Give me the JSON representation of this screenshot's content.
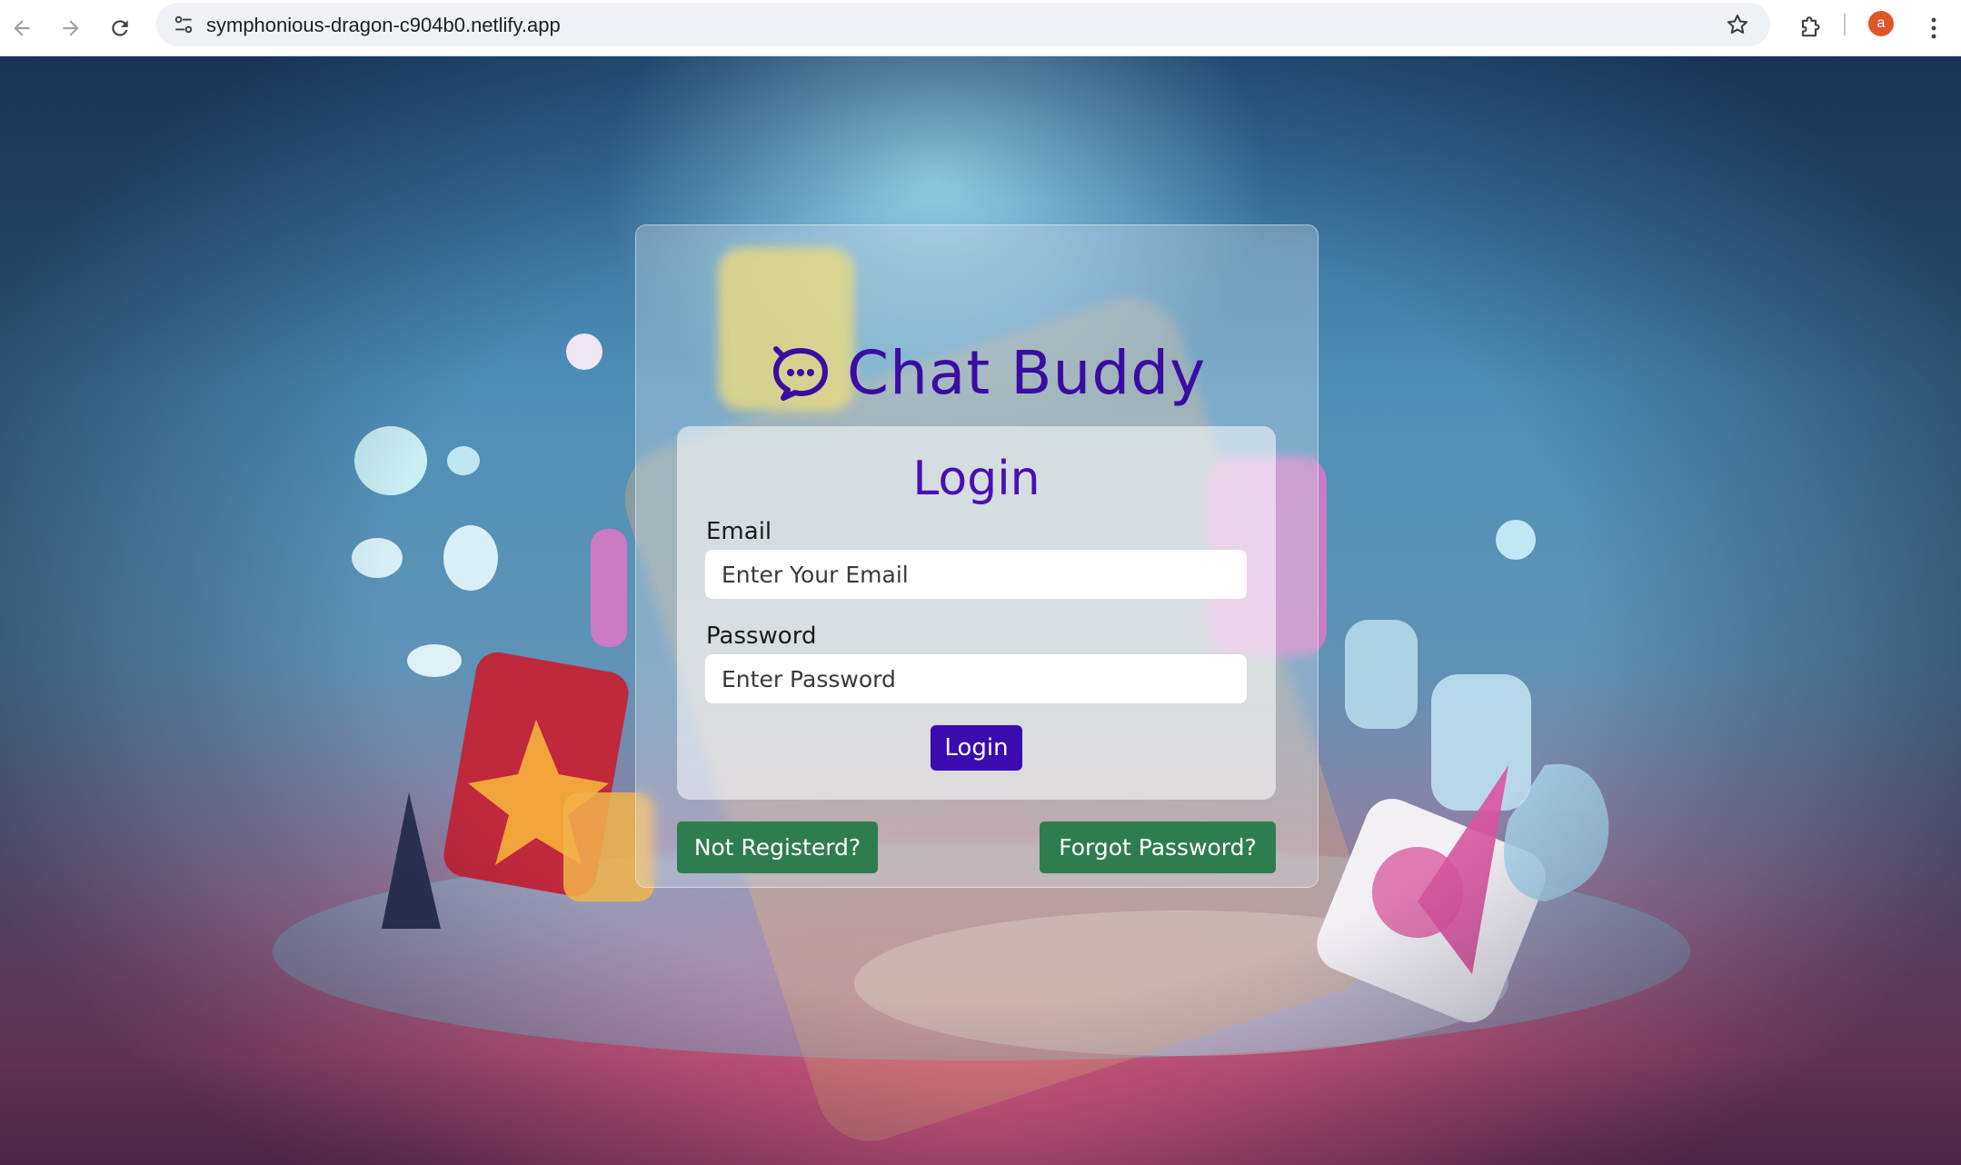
{
  "browser": {
    "url": "symphonious-dragon-c904b0.netlify.app",
    "profile_initial": "a"
  },
  "app": {
    "brand_title": "Chat Buddy",
    "brand_icon": "chat-bubble-icon"
  },
  "login_form": {
    "heading": "Login",
    "email_label": "Email",
    "email_placeholder": "Enter Your Email",
    "password_label": "Password",
    "password_placeholder": "Enter Password",
    "submit_label": "Login"
  },
  "links": {
    "not_registered": "Not Registerd?",
    "forgot_password": "Forgot Password?"
  },
  "colors": {
    "brand": "#3a0ca3",
    "login_button": "#3a0cb0",
    "secondary_button": "#2e7d4f"
  }
}
